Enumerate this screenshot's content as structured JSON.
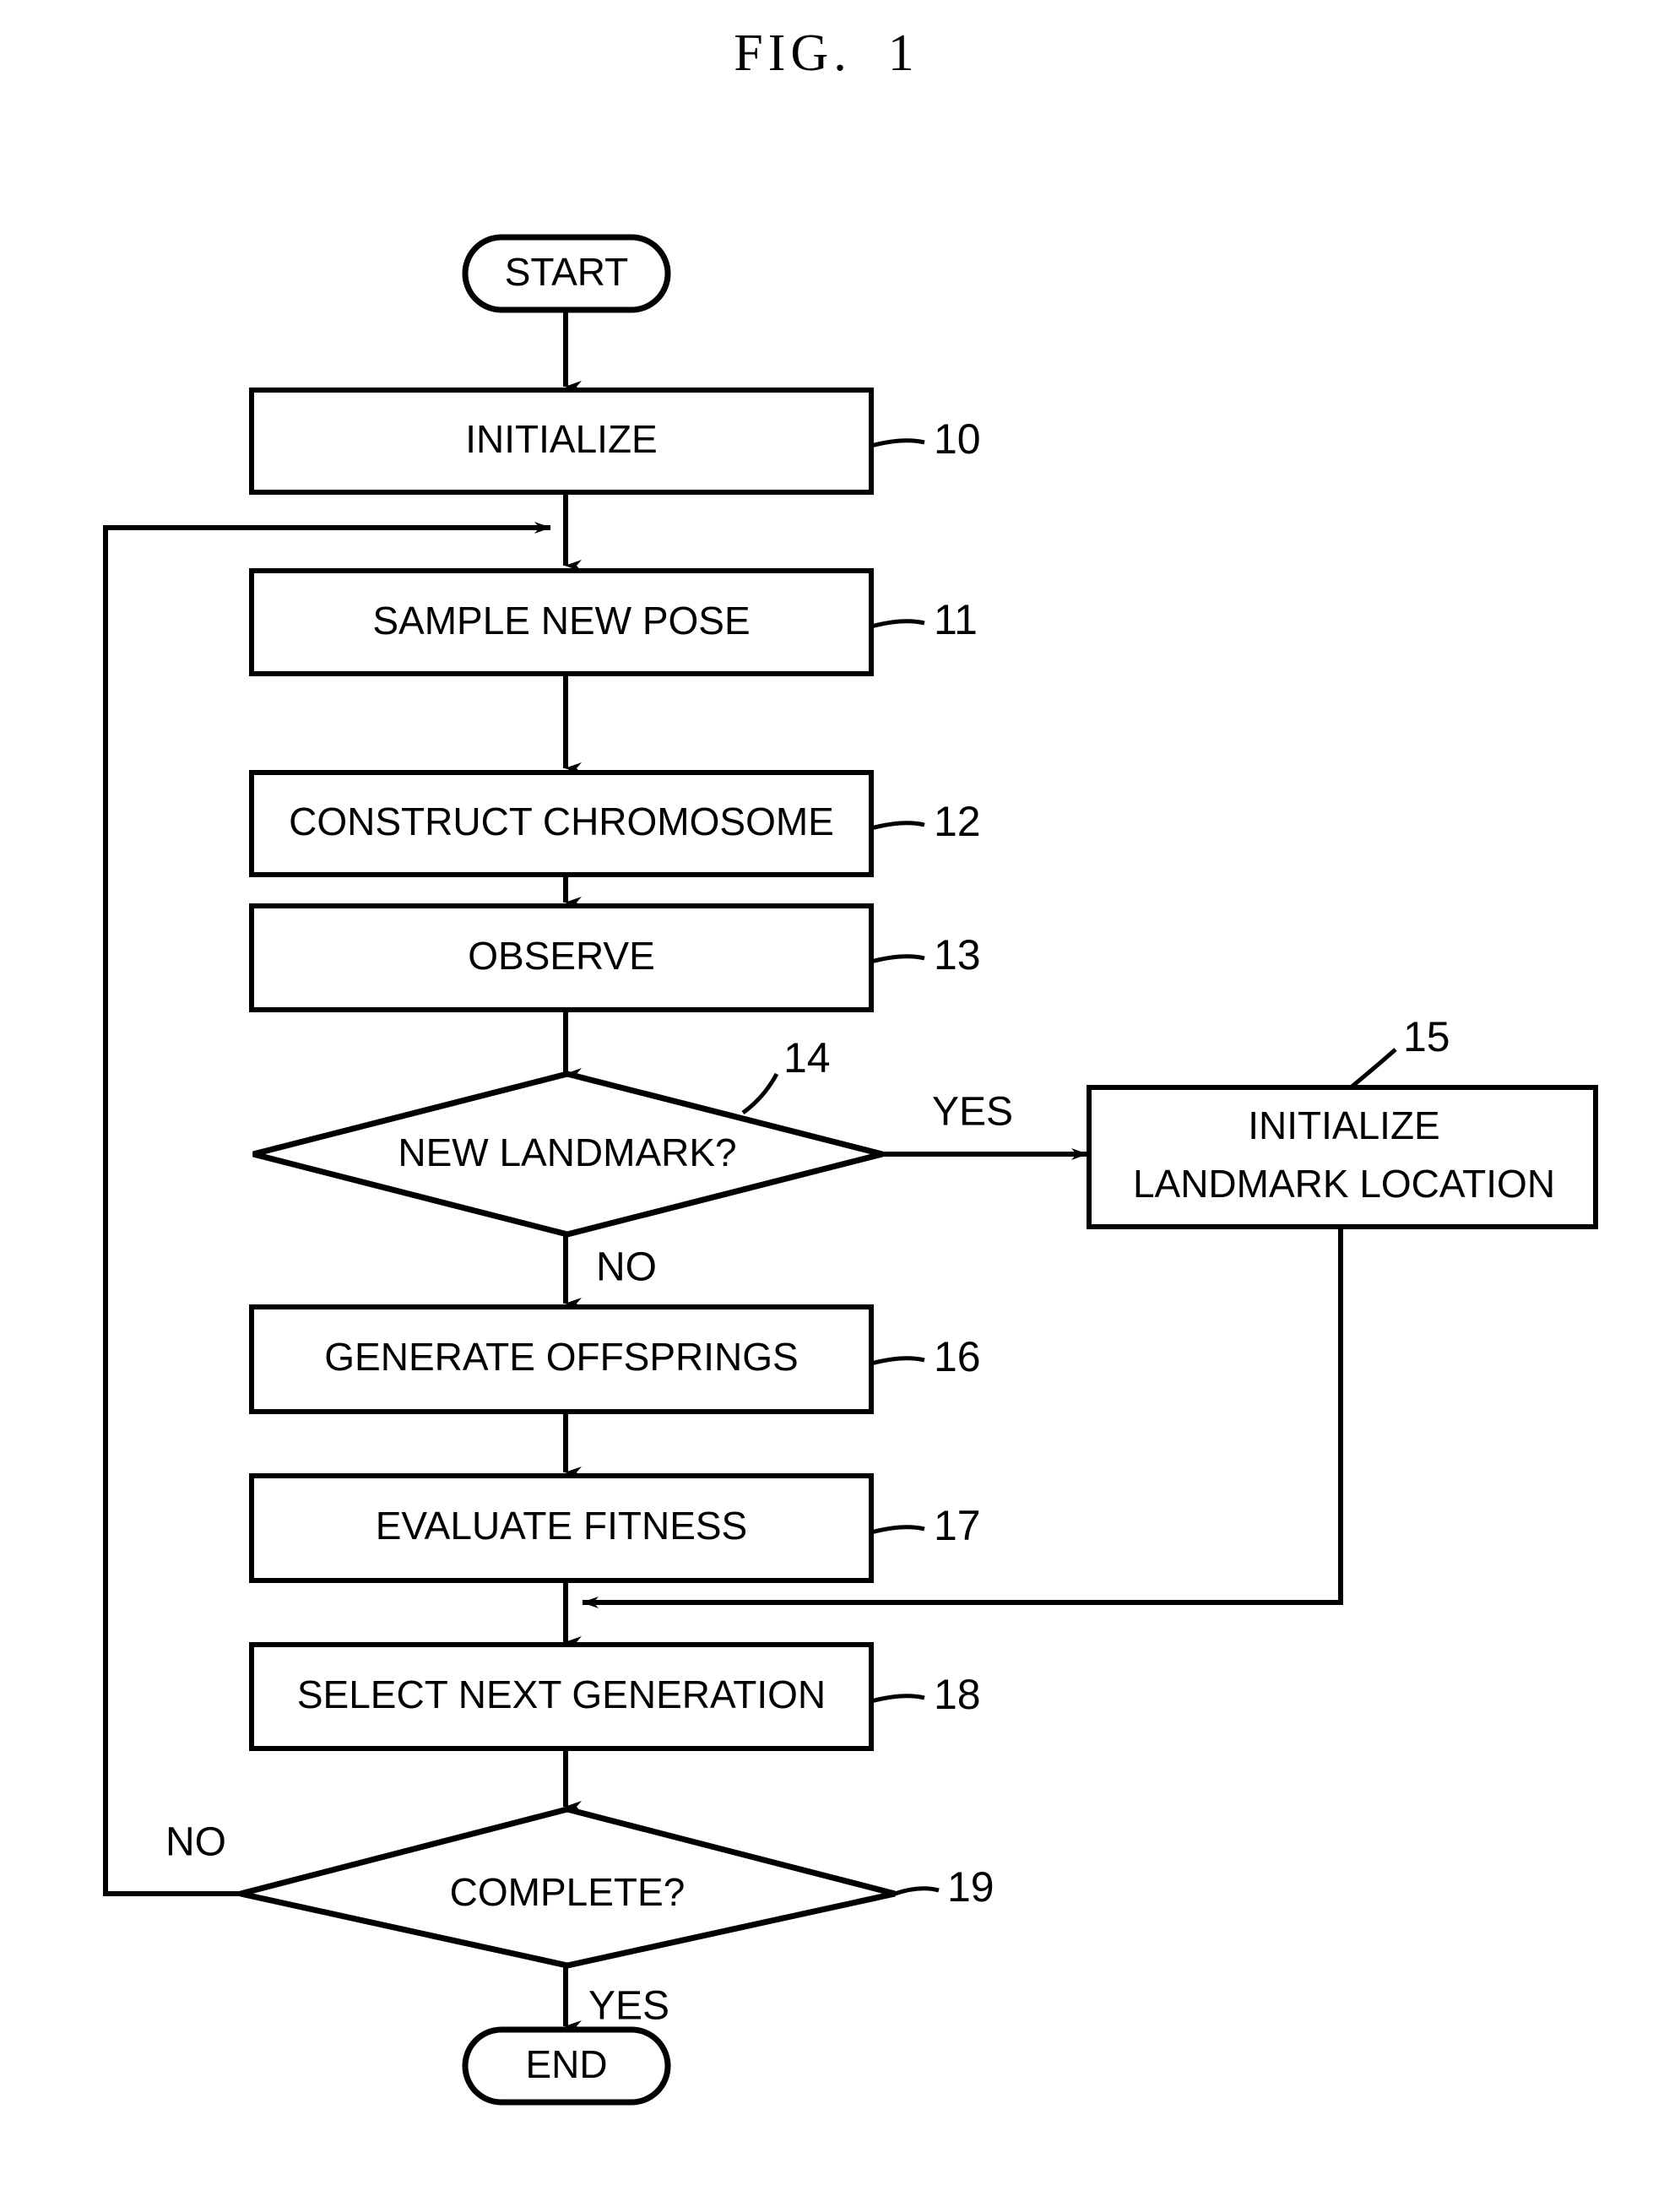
{
  "figure": {
    "title": "FIG.  1"
  },
  "flowchart": {
    "type": "process-flowchart",
    "start_label": "START",
    "end_label": "END",
    "nodes": [
      {
        "id": "start",
        "shape": "terminator",
        "label": "START",
        "ref": ""
      },
      {
        "id": "n10",
        "shape": "process",
        "label": "INITIALIZE",
        "ref": "10"
      },
      {
        "id": "n11",
        "shape": "process",
        "label": "SAMPLE NEW POSE",
        "ref": "11"
      },
      {
        "id": "n12",
        "shape": "process",
        "label": "CONSTRUCT CHROMOSOME",
        "ref": "12"
      },
      {
        "id": "n13",
        "shape": "process",
        "label": "OBSERVE",
        "ref": "13"
      },
      {
        "id": "n14",
        "shape": "decision",
        "label": "NEW LANDMARK?",
        "ref": "14"
      },
      {
        "id": "n15",
        "shape": "process",
        "label_line1": "INITIALIZE",
        "label_line2": "LANDMARK LOCATION",
        "ref": "15"
      },
      {
        "id": "n16",
        "shape": "process",
        "label": "GENERATE OFFSPRINGS",
        "ref": "16"
      },
      {
        "id": "n17",
        "shape": "process",
        "label": "EVALUATE FITNESS",
        "ref": "17"
      },
      {
        "id": "n18",
        "shape": "process",
        "label": "SELECT NEXT GENERATION",
        "ref": "18"
      },
      {
        "id": "n19",
        "shape": "decision",
        "label": "COMPLETE?",
        "ref": "19"
      },
      {
        "id": "end",
        "shape": "terminator",
        "label": "END",
        "ref": ""
      }
    ],
    "branch_labels": {
      "n14_yes": "YES",
      "n14_no": "NO",
      "n19_yes": "YES",
      "n19_no": "NO"
    },
    "reference_numbers": [
      "10",
      "11",
      "12",
      "13",
      "14",
      "15",
      "16",
      "17",
      "18",
      "19"
    ],
    "colors": {
      "stroke": "#000000",
      "fill": "#ffffff",
      "text": "#000000"
    }
  }
}
